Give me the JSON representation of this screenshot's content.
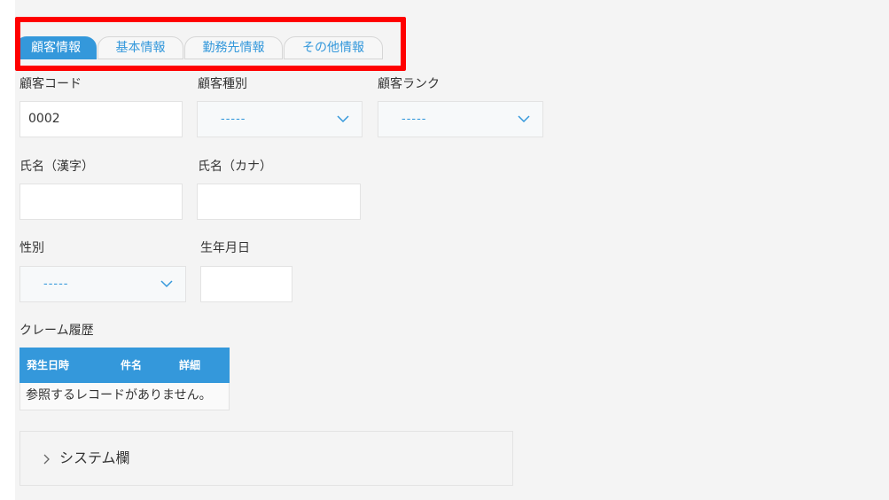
{
  "tabs": [
    {
      "label": "顧客情報"
    },
    {
      "label": "基本情報"
    },
    {
      "label": "勤務先情報"
    },
    {
      "label": "その他情報"
    }
  ],
  "fields": {
    "customer_code": {
      "label": "顧客コード",
      "value": "0002"
    },
    "customer_type": {
      "label": "顧客種別",
      "value": "-----"
    },
    "customer_rank": {
      "label": "顧客ランク",
      "value": "-----"
    },
    "name_kanji": {
      "label": "氏名（漢字）",
      "value": ""
    },
    "name_kana": {
      "label": "氏名（カナ）",
      "value": ""
    },
    "gender": {
      "label": "性別",
      "value": "-----"
    },
    "birthdate": {
      "label": "生年月日",
      "value": ""
    }
  },
  "claims": {
    "label": "クレーム履歴",
    "columns": [
      "発生日時",
      "件名",
      "詳細"
    ],
    "empty_text": "参照するレコードがありません。"
  },
  "system_section": {
    "label": "システム欄"
  },
  "colors": {
    "accent": "#3498db",
    "highlight": "#ff0000"
  }
}
